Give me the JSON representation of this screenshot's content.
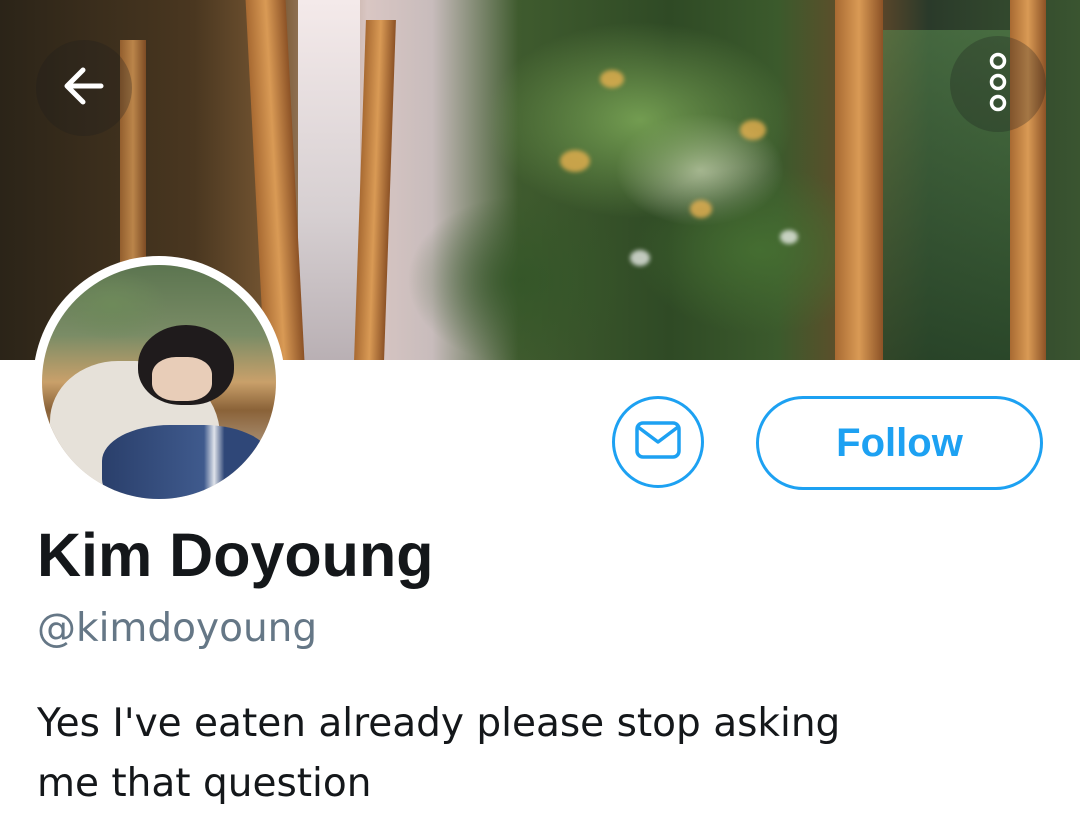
{
  "profile": {
    "display_name": "Kim Doyoung",
    "handle": "@kimdoyoung",
    "bio": "Yes I've eaten already please stop asking me that question"
  },
  "actions": {
    "follow_label": "Follow"
  },
  "icons": {
    "back": "arrow-left-icon",
    "more": "more-vertical-icon",
    "message": "envelope-icon"
  },
  "colors": {
    "accent": "#1da1f2",
    "primary_text": "#14171a",
    "secondary_text": "#657786",
    "background": "#ffffff"
  }
}
